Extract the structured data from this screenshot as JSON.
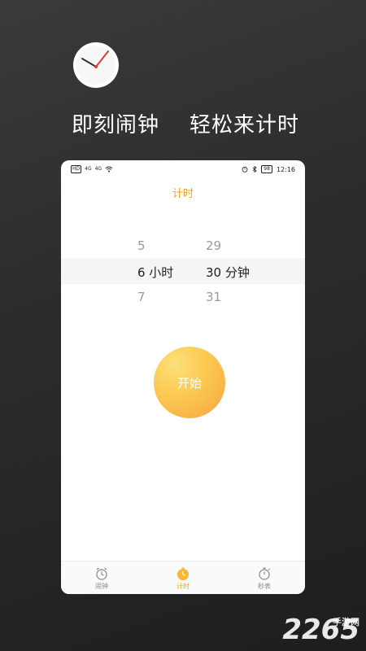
{
  "promo": {
    "headline": "即刻闹钟    轻松来计时"
  },
  "status_bar": {
    "left_icons": [
      "HD",
      "4G",
      "4G",
      "wifi-icon"
    ],
    "battery": "98",
    "time": "12:16"
  },
  "screen": {
    "title": "计时",
    "picker": {
      "hours": {
        "prev": "5",
        "selected": "6 小时",
        "next": "7"
      },
      "minutes": {
        "prev": "29",
        "selected": "30 分钟",
        "next": "31"
      }
    },
    "start_label": "开始"
  },
  "tabs": [
    {
      "label": "闹钟",
      "icon": "alarm-clock-icon",
      "active": false
    },
    {
      "label": "计时",
      "icon": "timer-icon",
      "active": true
    },
    {
      "label": "秒表",
      "icon": "stopwatch-icon",
      "active": false
    }
  ],
  "watermark": {
    "text": "2265",
    "sub": "手游网"
  },
  "colors": {
    "accent": "#f0a500",
    "start_button": "#fbc84f",
    "background": "#2b2b2b"
  }
}
